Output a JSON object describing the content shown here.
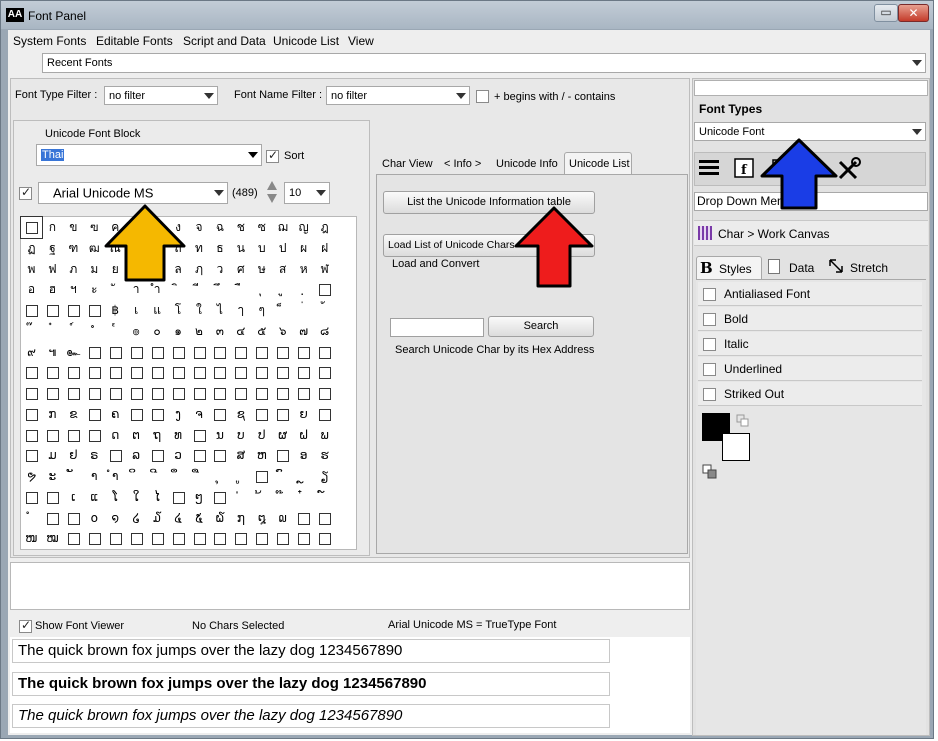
{
  "window": {
    "title": "Font Panel",
    "logo": "AA",
    "minimize": "▭",
    "close": "✕"
  },
  "menu": [
    "System Fonts",
    "Editable Fonts",
    "Script and Data",
    "Unicode List",
    "View"
  ],
  "recent_fonts": "Recent Fonts",
  "filters": {
    "type_label": "Font Type Filter :",
    "type_value": "no filter",
    "name_label": "Font Name Filter :",
    "name_value": "no filter",
    "begins_label": "+ begins with / - contains"
  },
  "block": {
    "label": "Unicode Font Block",
    "value": "Thai",
    "sort_label": "Sort"
  },
  "font": {
    "name": "Arial Unicode MS",
    "count": "(489)",
    "size": "10"
  },
  "glyph_rows": [
    [
      "□",
      "ก",
      "ข",
      "ฃ",
      "ค",
      "ฅ",
      "ฆ",
      "ง",
      "จ",
      "ฉ",
      "ช",
      "ซ",
      "ฌ",
      "ญ",
      "ฎ"
    ],
    [
      "ฏ",
      "ฐ",
      "ฑ",
      "ฒ",
      "ณ",
      "ด",
      "ต",
      "ถ",
      "ท",
      "ธ",
      "น",
      "บ",
      "ป",
      "ผ",
      "ฝ"
    ],
    [
      "พ",
      "ฟ",
      "ภ",
      "ม",
      "ย",
      "ร",
      "ฤ",
      "ล",
      "ฦ",
      "ว",
      "ศ",
      "ษ",
      "ส",
      "ห",
      "ฬ"
    ],
    [
      "อ",
      "ฮ",
      "ฯ",
      "ะ",
      "ั",
      "า",
      "ำ",
      "ิ",
      "ี",
      "ึ",
      "ื",
      "ุ",
      "ู",
      "ฺ",
      "□"
    ],
    [
      "□",
      "□",
      "□",
      "□",
      "฿",
      "เ",
      "แ",
      "โ",
      "ใ",
      "ไ",
      "ๅ",
      "ๆ",
      "็",
      "่",
      "้"
    ],
    [
      "๊",
      "๋",
      "์",
      "ํ",
      "๎",
      "๏",
      "๐",
      "๑",
      "๒",
      "๓",
      "๔",
      "๕",
      "๖",
      "๗",
      "๘"
    ],
    [
      "๙",
      "๚",
      "๛",
      "□",
      "□",
      "□",
      "□",
      "□",
      "□",
      "□",
      "□",
      "□",
      "□",
      "□",
      "□"
    ],
    [
      "□",
      "□",
      "□",
      "□",
      "□",
      "□",
      "□",
      "□",
      "□",
      "□",
      "□",
      "□",
      "□",
      "□",
      "□"
    ],
    [
      "□",
      "□",
      "□",
      "□",
      "□",
      "□",
      "□",
      "□",
      "□",
      "□",
      "□",
      "□",
      "□",
      "□",
      "□"
    ],
    [
      "□",
      "ກ",
      "ຂ",
      "□",
      "ຄ",
      "□",
      "□",
      "ງ",
      "ຈ",
      "□",
      "ຊ",
      "□",
      "□",
      "ຍ",
      "□"
    ],
    [
      "□",
      "□",
      "□",
      "□",
      "ດ",
      "ຕ",
      "ຖ",
      "ທ",
      "□",
      "ນ",
      "ບ",
      "ປ",
      "ຜ",
      "ຝ",
      "ພ"
    ],
    [
      "□",
      "ມ",
      "ຢ",
      "ຣ",
      "□",
      "ລ",
      "□",
      "ວ",
      "□",
      "□",
      "ສ",
      "ຫ",
      "□",
      "ອ",
      "ຮ"
    ],
    [
      "ຯ",
      "ະ",
      "ັ",
      "າ",
      "ຳ",
      "ິ",
      "ີ",
      "ຶ",
      "ື",
      "ຸ",
      "ູ",
      "□",
      "ົ",
      "ຼ",
      "ຽ"
    ],
    [
      "□",
      "□",
      "ເ",
      "ແ",
      "ໂ",
      "ໃ",
      "ໄ",
      "□",
      "ໆ",
      "□",
      "່",
      "້",
      "໊",
      "໋",
      "໌"
    ],
    [
      "ໍ",
      "□",
      "□",
      "໐",
      "໑",
      "໒",
      "໓",
      "໔",
      "໕",
      "໖",
      "໗",
      "໘",
      "໙",
      "□",
      "□"
    ],
    [
      "ໜ",
      "ໝ",
      "□",
      "□",
      "□",
      "□",
      "□",
      "□",
      "□",
      "□",
      "□",
      "□",
      "□",
      "□",
      "□"
    ]
  ],
  "tabs": [
    "Char View",
    "< Info >",
    "Unicode Info",
    "Unicode List"
  ],
  "unicode_list": {
    "list_btn": "List the Unicode Information table",
    "load_btn": "Load List of Unicode Chars",
    "load_caption": "Load and Convert",
    "search_btn": "Search",
    "search_caption": "Search Unicode Char by its Hex Address",
    "search_value": ""
  },
  "status": {
    "show_viewer": "Show Font Viewer",
    "chars_selected": "No Chars Selected",
    "font_info": "Arial Unicode MS = TrueType Font"
  },
  "samples": [
    "The quick brown fox jumps over the lazy dog 1234567890",
    "The quick brown fox jumps over the lazy dog 1234567890",
    "The quick brown fox jumps over the lazy dog 1234567890"
  ],
  "right": {
    "font_types_label": "Font Types",
    "font_types_value": "Unicode Font",
    "drop_down_label": "Drop Down Menu",
    "char_work": "Char > Work Canvas",
    "tabs": [
      "Styles",
      "Data",
      "Stretch"
    ],
    "style_options": [
      "Antialiased Font",
      "Bold",
      "Italic",
      "Underlined",
      "Striked Out"
    ]
  },
  "colors": {
    "arrow_yellow": "#f5b800",
    "arrow_red": "#ee1c1c",
    "arrow_blue": "#1a3de6"
  }
}
